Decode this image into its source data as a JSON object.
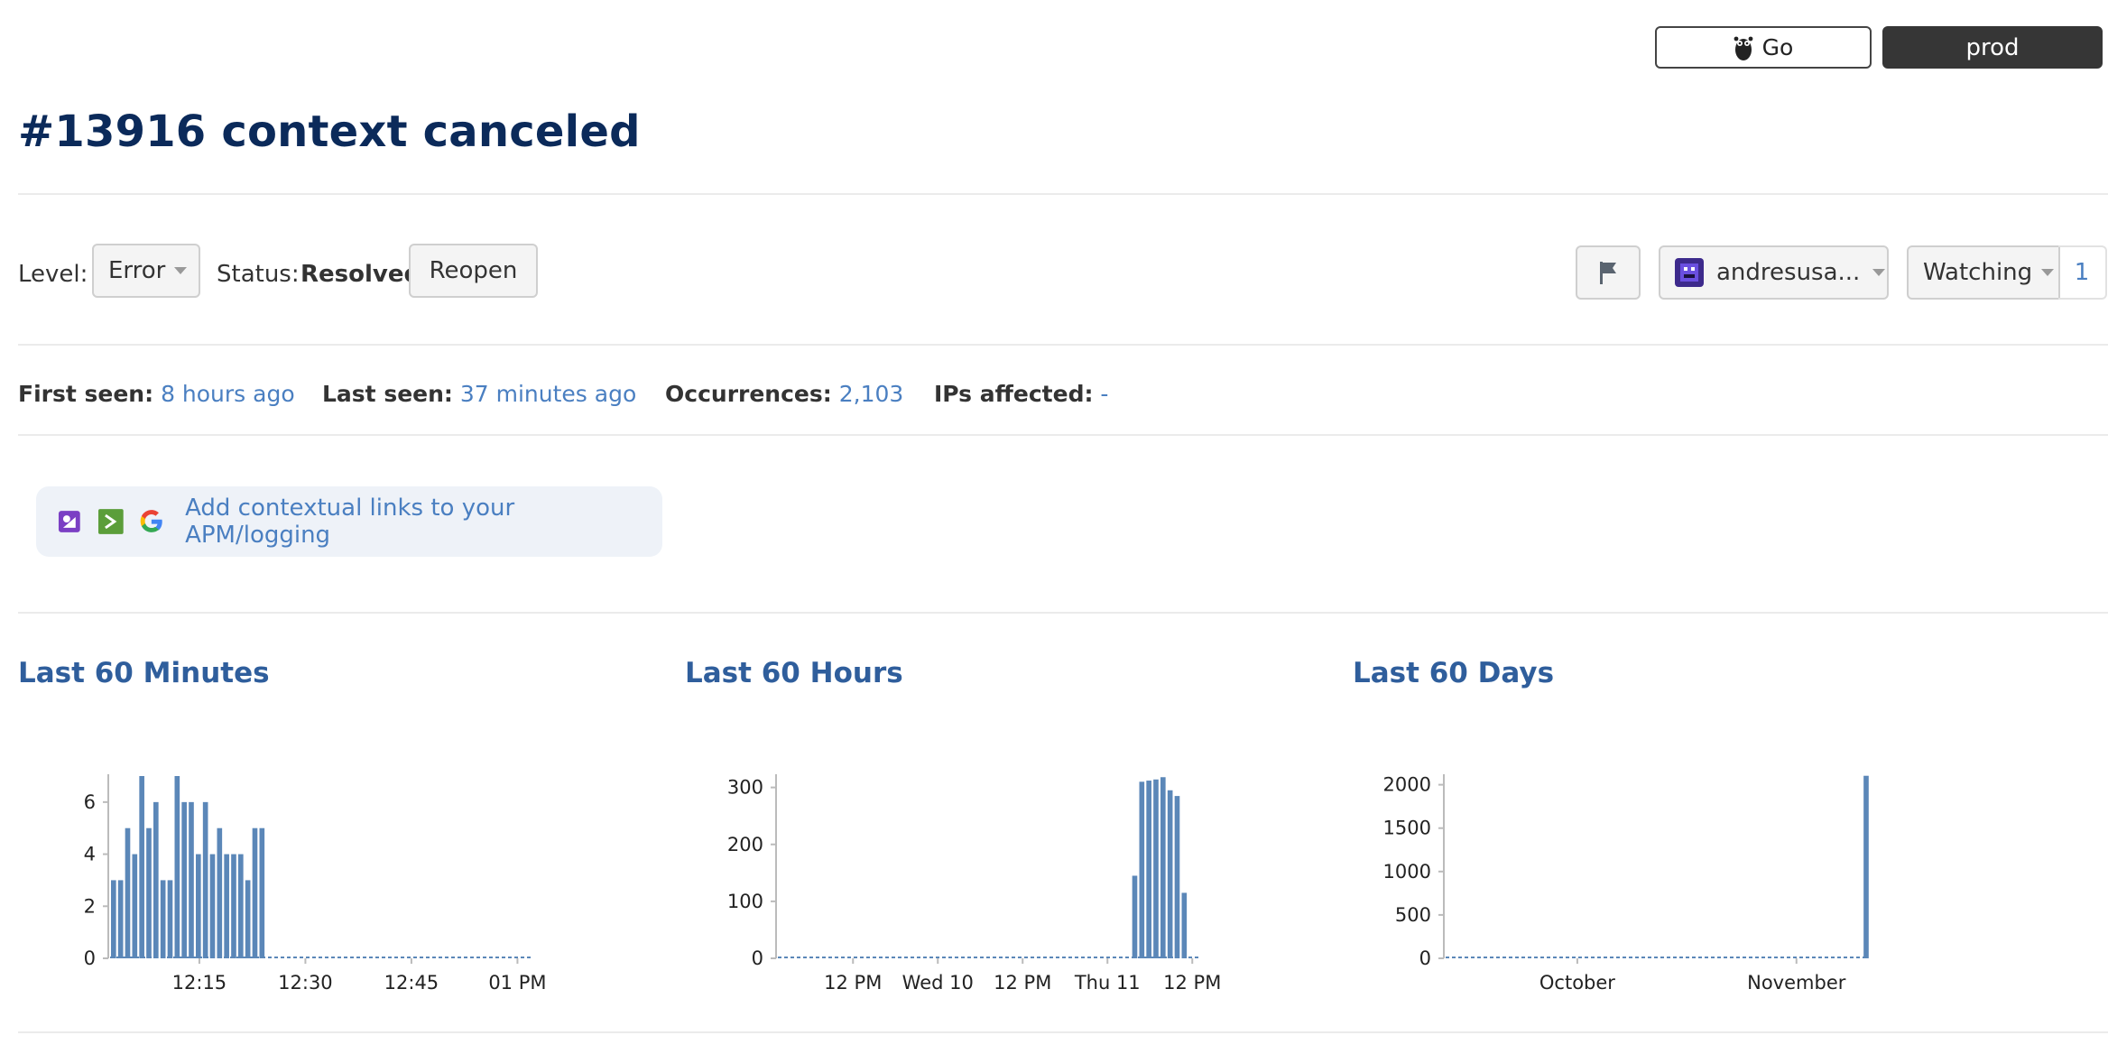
{
  "env": {
    "go_label": "Go",
    "prod_label": "prod"
  },
  "title": "#13916 context canceled",
  "controls": {
    "level_label": "Level:",
    "level_value": "Error",
    "status_label": "Status:",
    "status_value": "Resolved",
    "reopen_label": "Reopen",
    "assignee": "andresusa...",
    "watch_label": "Watching",
    "watch_count": "1"
  },
  "meta": {
    "first_seen_label": "First seen:",
    "first_seen_value": "8 hours ago",
    "last_seen_label": "Last seen:",
    "last_seen_value": "37 minutes ago",
    "occurrences_label": "Occurrences:",
    "occurrences_value": "2,103",
    "ips_label": "IPs affected:",
    "ips_value": "-"
  },
  "context_links": {
    "text": "Add contextual links to your APM/logging"
  },
  "colors": {
    "bar": "#5b87b8",
    "title": "#0b2a5a",
    "link": "#4a7fc1"
  },
  "chart_data": [
    {
      "type": "bar",
      "title": "Last 60 Minutes",
      "ylim": [
        0,
        7
      ],
      "yticks": [
        0,
        2,
        4,
        6
      ],
      "xticks": [
        "12:15",
        "12:30",
        "12:45",
        "01 PM"
      ],
      "xtick_index": [
        12,
        27,
        42,
        57
      ],
      "values": [
        3,
        3,
        5,
        4,
        7,
        5,
        6,
        3,
        3,
        7,
        6,
        6,
        4,
        6,
        4,
        5,
        4,
        4,
        4,
        3,
        5,
        5,
        0,
        0,
        0,
        0,
        0,
        0,
        0,
        0,
        0,
        0,
        0,
        0,
        0,
        0,
        0,
        0,
        0,
        0,
        0,
        0,
        0,
        0,
        0,
        0,
        0,
        0,
        0,
        0,
        0,
        0,
        0,
        0,
        0,
        0,
        0,
        0,
        0,
        0
      ]
    },
    {
      "type": "bar",
      "title": "Last 60 Hours",
      "ylim": [
        0,
        320
      ],
      "yticks": [
        0,
        100,
        200,
        300
      ],
      "xticks": [
        "12 PM",
        "Wed 10",
        "12 PM",
        "Thu 11",
        "12 PM"
      ],
      "xtick_index": [
        10,
        22,
        34,
        46,
        58
      ],
      "values": [
        0,
        0,
        0,
        0,
        0,
        0,
        0,
        0,
        0,
        0,
        0,
        0,
        0,
        0,
        0,
        0,
        0,
        0,
        0,
        0,
        0,
        0,
        0,
        0,
        0,
        0,
        0,
        0,
        0,
        0,
        0,
        0,
        0,
        0,
        0,
        0,
        0,
        0,
        0,
        0,
        0,
        0,
        0,
        0,
        0,
        0,
        0,
        0,
        0,
        0,
        145,
        310,
        312,
        314,
        318,
        295,
        285,
        115,
        0,
        0
      ]
    },
    {
      "type": "bar",
      "title": "Last 60 Days",
      "ylim": [
        0,
        2100
      ],
      "yticks": [
        0,
        500,
        1000,
        1500,
        2000
      ],
      "xticks": [
        "October",
        "November"
      ],
      "xtick_index": [
        18,
        49
      ],
      "values": [
        0,
        0,
        0,
        0,
        0,
        0,
        0,
        0,
        0,
        0,
        0,
        0,
        0,
        0,
        0,
        0,
        0,
        0,
        0,
        0,
        0,
        0,
        0,
        0,
        0,
        0,
        0,
        0,
        0,
        0,
        0,
        0,
        0,
        0,
        0,
        0,
        0,
        0,
        0,
        0,
        0,
        0,
        0,
        0,
        0,
        0,
        0,
        0,
        0,
        0,
        0,
        0,
        0,
        0,
        0,
        0,
        0,
        0,
        0,
        2103
      ]
    }
  ]
}
